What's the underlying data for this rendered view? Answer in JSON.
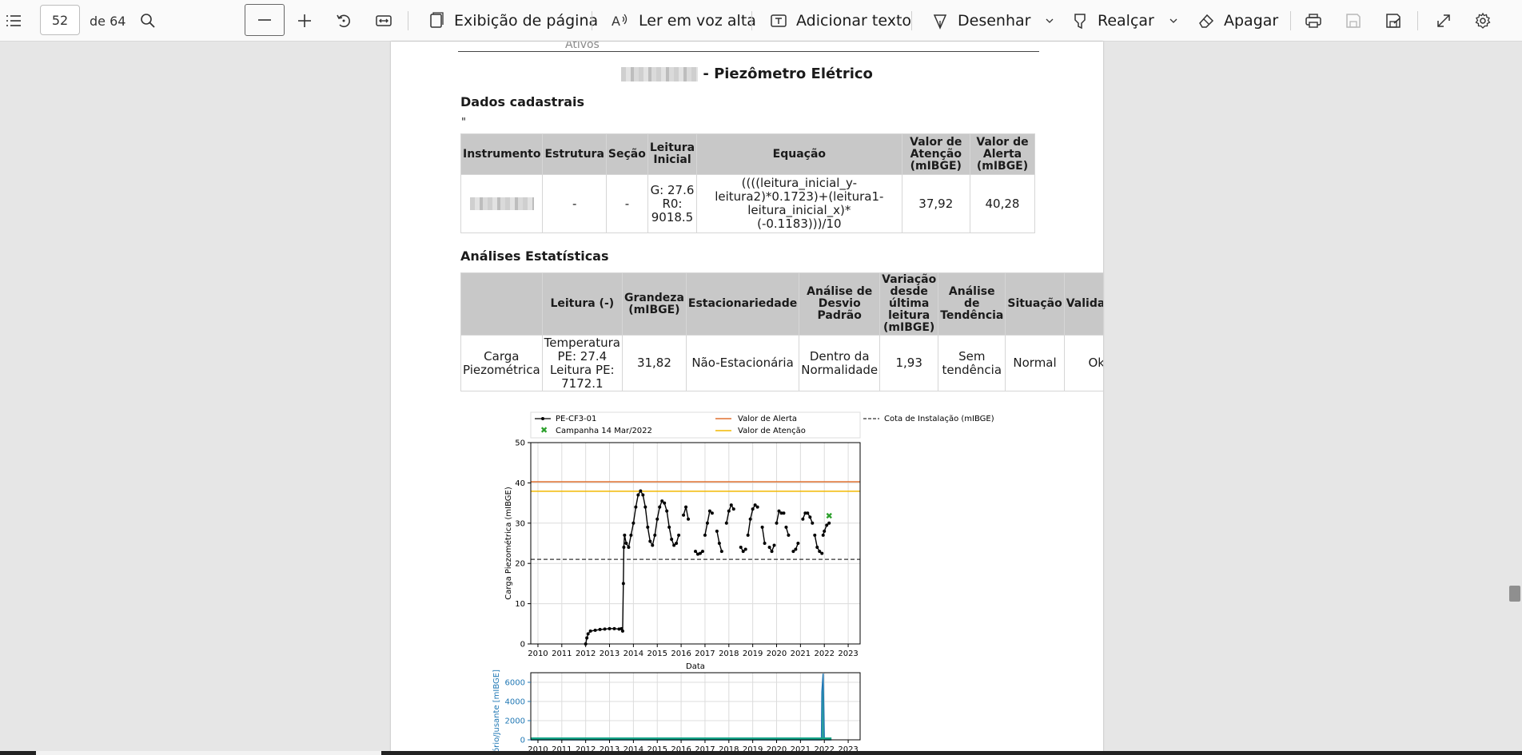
{
  "toolbar": {
    "page_number": "52",
    "page_total": "de 64",
    "page_view_label": "Exibição de página",
    "read_aloud_label": "Ler em voz alta",
    "add_text_label": "Adicionar texto",
    "draw_label": "Desenhar",
    "highlight_label": "Realçar",
    "erase_label": "Apagar"
  },
  "doc": {
    "ativos": "Ativos",
    "title_suffix": " - Piezômetro Elétrico",
    "section_cadastro": "Dados cadastrais",
    "quote_mark": "\"",
    "section_stats": "Análises Estatísticas",
    "cadastro": {
      "headers": [
        "Instrumento",
        "Estrutura",
        "Seção",
        "Leitura Inicial",
        "Equação",
        "Valor de Atenção (mIBGE)",
        "Valor de Alerta (mIBGE)"
      ],
      "row": {
        "estrutura": "-",
        "secao": "-",
        "leitura_inicial": "G: 27.6 R0: 9018.5",
        "equacao": "((((leitura_inicial_y-leitura2)*0.1723)+(leitura1-leitura_inicial_x)*(-0.1183)))/10",
        "atencao": "37,92",
        "alerta": "40,28"
      }
    },
    "stats": {
      "headers": [
        "",
        "Leitura (-)",
        "Grandeza (mIBGE)",
        "Estacionariedade",
        "Análise de Desvio Padrão",
        "Variação desde última leitura (mIBGE)",
        "Análise de Tendência",
        "Situação",
        "Validação"
      ],
      "row": {
        "grandeza_nome": "Carga Piezométrica",
        "leitura": "Temperatura PE: 27.4 Leitura PE: 7172.1",
        "grandeza": "31,82",
        "estacionariedade": "Não-Estacionária",
        "desvio": "Dentro da Normalidade",
        "variacao": "1,93",
        "tendencia": "Sem tendência",
        "situacao": "Normal",
        "validacao": "Ok"
      }
    }
  },
  "chart_data": [
    {
      "type": "line",
      "xlabel": "Data",
      "ylabel": "Carga Piezométrica (mIBGE)",
      "x_ticks": [
        "2010",
        "2011",
        "2012",
        "2013",
        "2014",
        "2015",
        "2016",
        "2017",
        "2018",
        "2019",
        "2020",
        "2021",
        "2022",
        "2023"
      ],
      "y_ticks": [
        "0",
        "10",
        "20",
        "30",
        "40",
        "50"
      ],
      "ylim": [
        0,
        50
      ],
      "xlim": [
        2009.7,
        2023.5
      ],
      "grid": true,
      "legend": [
        "PE-CF3-01",
        "Campanha 14 Mar/2022",
        "Valor de Alerta",
        "Valor de Atenção",
        "Cota de Instalação (mIBGE)"
      ],
      "legend_placement": "top",
      "colors": {
        "series": "#000000",
        "campaign": "#2ca02c",
        "alerta": "#e07030",
        "atencao": "#f2b800",
        "cota": "#333333"
      },
      "hlines": {
        "alerta": 40.28,
        "atencao": 37.92,
        "cota": 21
      },
      "campaign_point": {
        "x": 2022.2,
        "y": 31.8
      },
      "series": [
        {
          "name": "PE-CF3-01",
          "segments": [
            [
              [
                2012.0,
                0
              ],
              [
                2012.05,
                1.5
              ],
              [
                2012.1,
                2.5
              ],
              [
                2012.2,
                3.2
              ],
              [
                2012.4,
                3.4
              ],
              [
                2012.6,
                3.6
              ],
              [
                2012.8,
                3.7
              ],
              [
                2013.0,
                3.8
              ],
              [
                2013.2,
                3.8
              ],
              [
                2013.4,
                3.7
              ],
              [
                2013.5,
                3.8
              ],
              [
                2013.55,
                3.2
              ],
              [
                2013.58,
                15
              ],
              [
                2013.6,
                24
              ],
              [
                2013.63,
                27
              ],
              [
                2013.7,
                25
              ],
              [
                2013.8,
                24
              ],
              [
                2013.9,
                27
              ],
              [
                2014.0,
                30
              ],
              [
                2014.1,
                34
              ],
              [
                2014.2,
                37
              ],
              [
                2014.3,
                38
              ],
              [
                2014.4,
                37
              ],
              [
                2014.5,
                34
              ],
              [
                2014.6,
                29
              ],
              [
                2014.7,
                25.5
              ],
              [
                2014.8,
                24.5
              ],
              [
                2014.9,
                27
              ],
              [
                2015.0,
                31
              ],
              [
                2015.1,
                34
              ],
              [
                2015.2,
                35.5
              ],
              [
                2015.3,
                35
              ],
              [
                2015.4,
                33
              ],
              [
                2015.5,
                29
              ],
              [
                2015.6,
                26
              ],
              [
                2015.7,
                24.5
              ],
              [
                2015.8,
                25
              ],
              [
                2015.9,
                27
              ]
            ],
            [
              [
                2016.1,
                32
              ],
              [
                2016.2,
                34
              ],
              [
                2016.3,
                31
              ]
            ],
            [
              [
                2016.6,
                23
              ],
              [
                2016.7,
                22.3
              ],
              [
                2016.8,
                22.5
              ],
              [
                2016.9,
                23
              ]
            ],
            [
              [
                2017.0,
                27
              ],
              [
                2017.1,
                30
              ],
              [
                2017.2,
                33
              ],
              [
                2017.3,
                32.5
              ]
            ],
            [
              [
                2017.5,
                28
              ],
              [
                2017.6,
                25
              ],
              [
                2017.7,
                23
              ]
            ],
            [
              [
                2017.9,
                30
              ],
              [
                2018.0,
                33
              ],
              [
                2018.1,
                34.5
              ],
              [
                2018.2,
                33.5
              ]
            ],
            [
              [
                2018.5,
                24
              ],
              [
                2018.6,
                23
              ],
              [
                2018.7,
                23.5
              ]
            ],
            [
              [
                2018.8,
                27
              ],
              [
                2018.9,
                31
              ],
              [
                2019.0,
                33.5
              ],
              [
                2019.1,
                34.5
              ],
              [
                2019.2,
                34
              ]
            ],
            [
              [
                2019.4,
                29
              ],
              [
                2019.5,
                25
              ]
            ],
            [
              [
                2019.7,
                24
              ],
              [
                2019.8,
                23
              ],
              [
                2019.9,
                24.5
              ]
            ],
            [
              [
                2020.0,
                30
              ],
              [
                2020.1,
                33
              ],
              [
                2020.2,
                32.5
              ],
              [
                2020.3,
                32.5
              ]
            ],
            [
              [
                2020.4,
                29
              ],
              [
                2020.5,
                27
              ]
            ],
            [
              [
                2020.7,
                23
              ],
              [
                2020.8,
                23.5
              ],
              [
                2020.9,
                25
              ]
            ],
            [
              [
                2021.1,
                31
              ],
              [
                2021.2,
                32.5
              ],
              [
                2021.3,
                32.5
              ],
              [
                2021.4,
                31.5
              ],
              [
                2021.5,
                30
              ]
            ],
            [
              [
                2021.6,
                27
              ],
              [
                2021.7,
                24
              ],
              [
                2021.8,
                23
              ],
              [
                2021.9,
                22.5
              ]
            ],
            [
              [
                2021.95,
                27
              ],
              [
                2022.0,
                28
              ],
              [
                2022.1,
                29.5
              ],
              [
                2022.2,
                30
              ]
            ]
          ]
        }
      ]
    },
    {
      "type": "line",
      "ylabel": "Reservatório/Jusante [mIBGE]",
      "x_ticks": [
        "2010",
        "2011",
        "2012",
        "2013",
        "2014",
        "2015",
        "2016",
        "2017",
        "2018",
        "2019",
        "2020",
        "2021",
        "2022",
        "2023"
      ],
      "y_ticks": [
        "0",
        "2000",
        "4000",
        "6000"
      ],
      "ylim": [
        0,
        7000
      ],
      "xlim": [
        2009.7,
        2023.5
      ],
      "grid": true,
      "colors": {
        "series": "#1f77b4",
        "fill": "#17a589"
      },
      "series": [
        {
          "name": "",
          "x": [
            2009.7,
            2021.88,
            2021.9,
            2021.95,
            2022.0,
            2022.05,
            2022.3
          ],
          "y": [
            0,
            0,
            5000,
            6900,
            200,
            0,
            0
          ]
        }
      ]
    }
  ]
}
